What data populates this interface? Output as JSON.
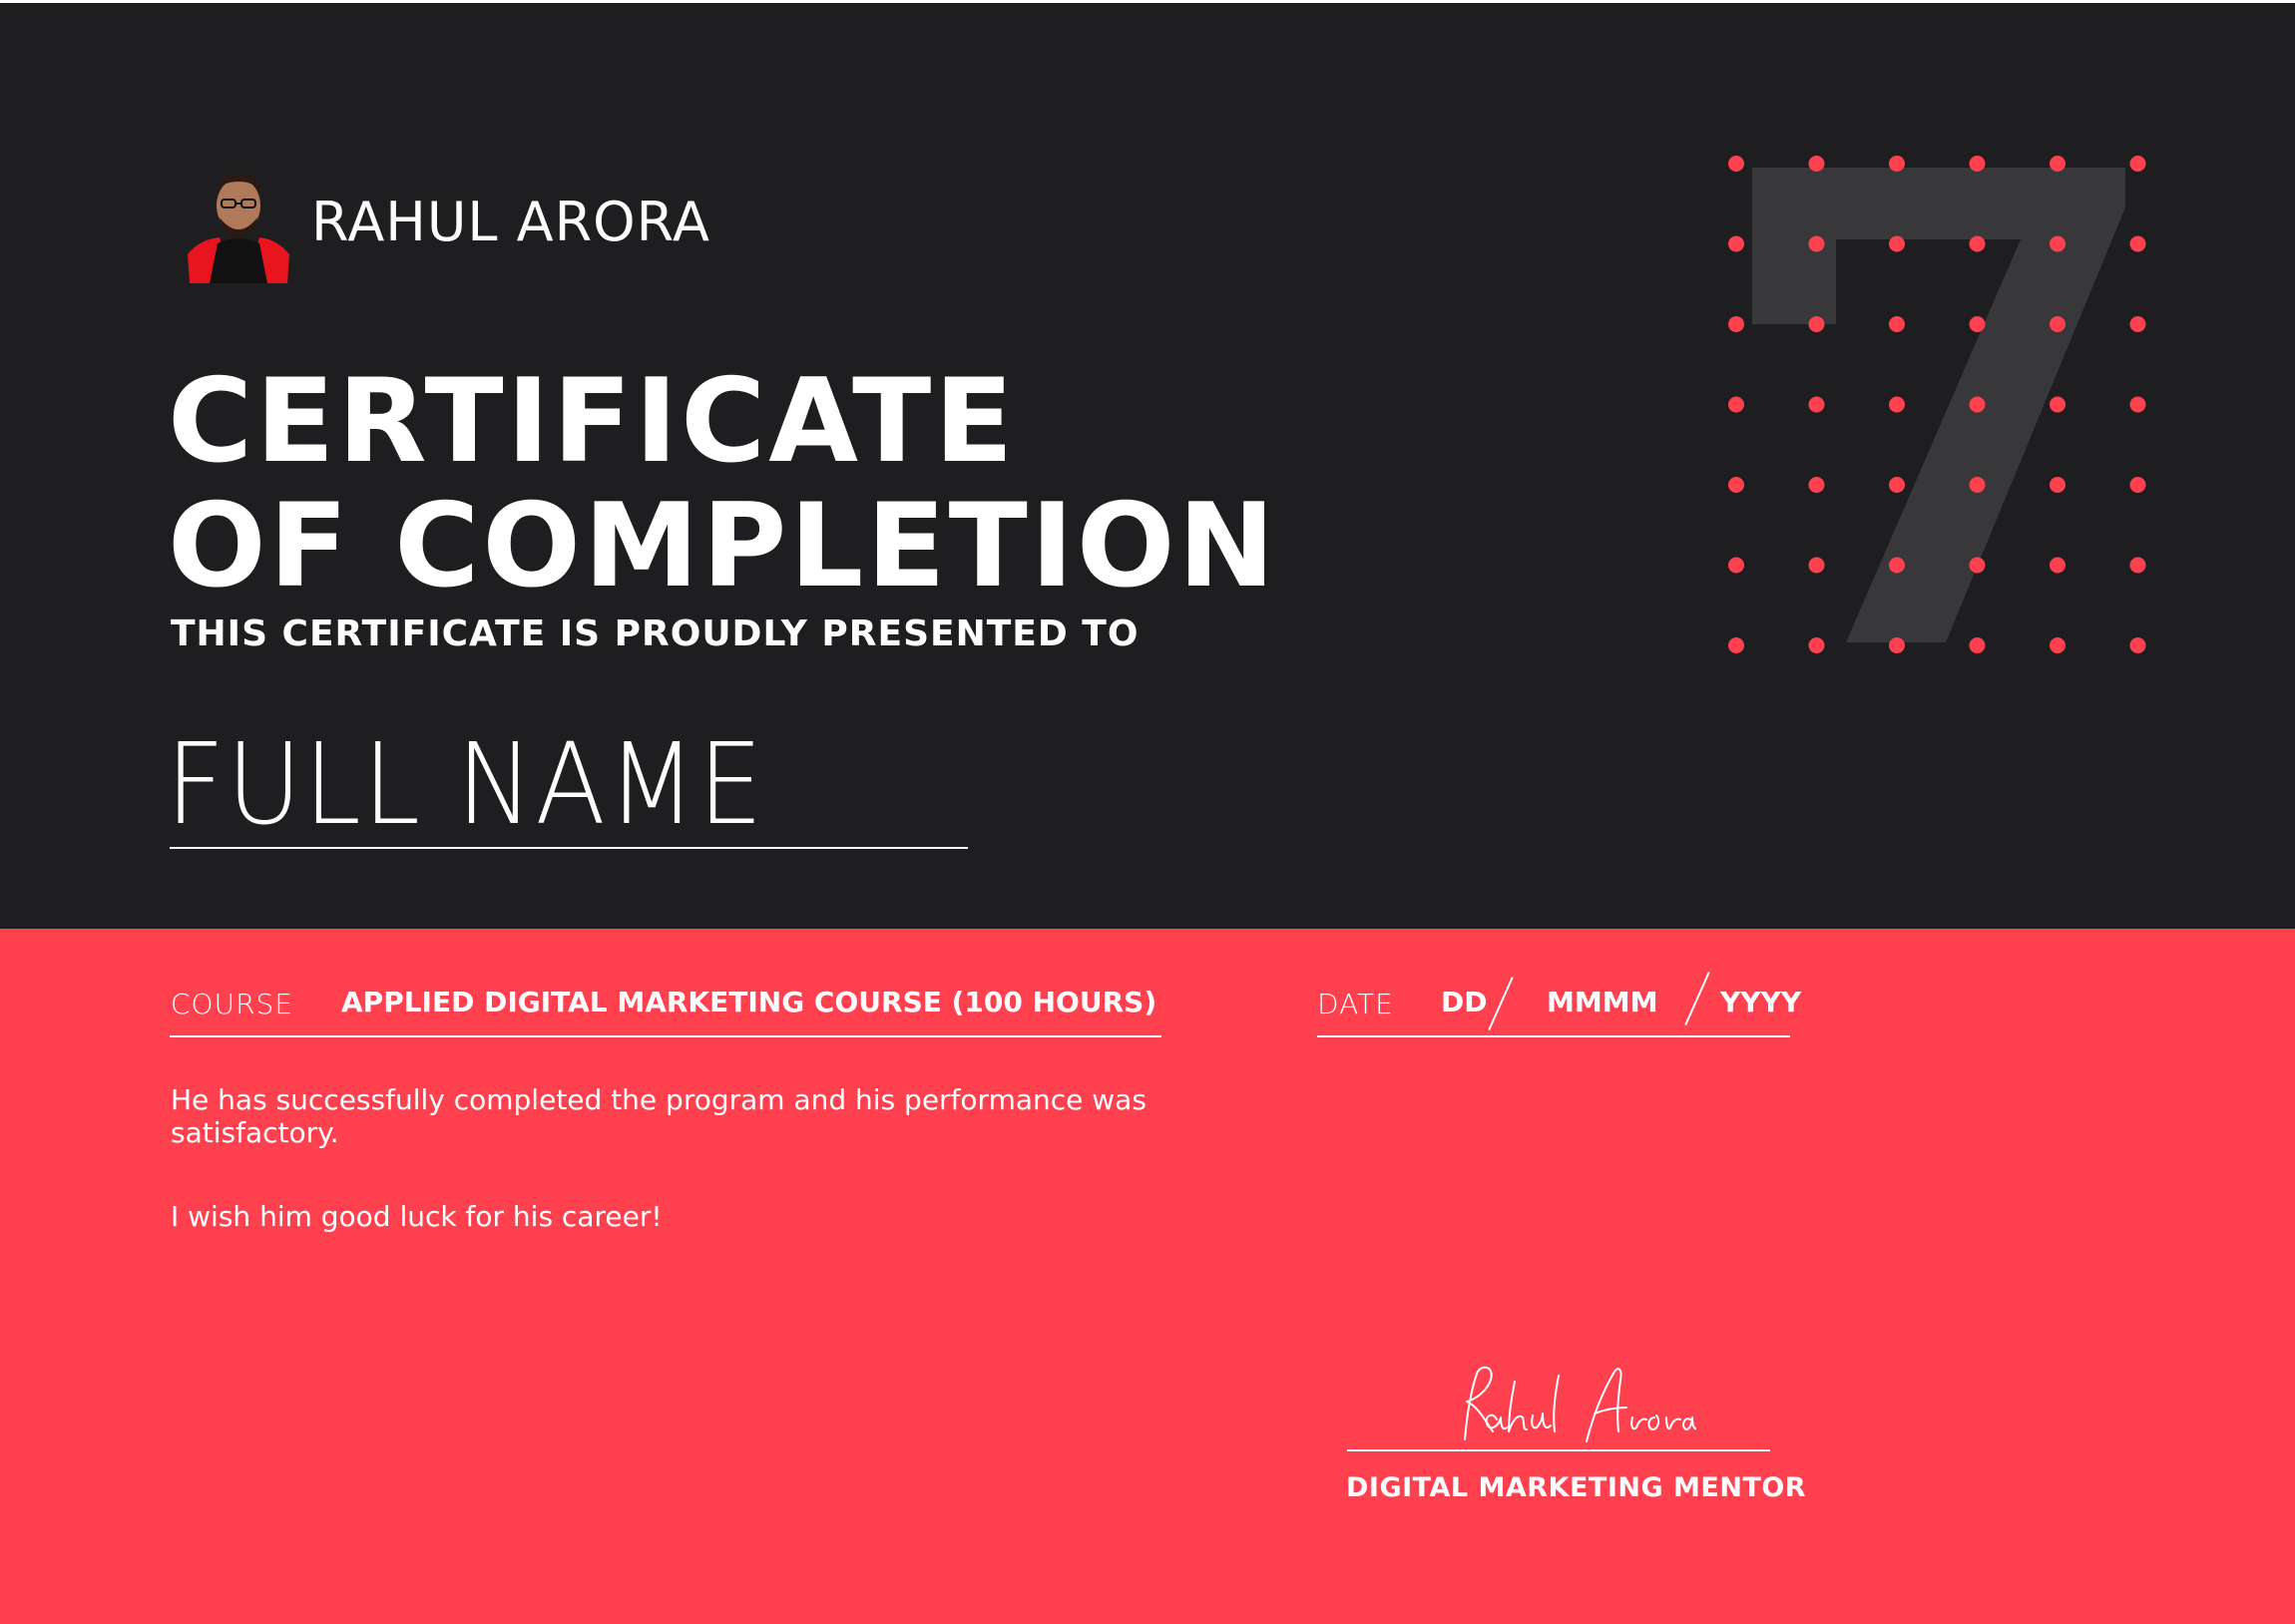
{
  "brand": {
    "name": "RAHUL ARORA",
    "avatar_icon": "profile-photo"
  },
  "certificate": {
    "title_line1": "CERTIFICATE",
    "title_line2": "OF COMPLETION",
    "presented_text": "THIS CERTIFICATE IS PROUDLY PRESENTED TO",
    "recipient_name": "FULL NAME"
  },
  "course": {
    "label": "COURSE",
    "value": "APPLIED DIGITAL MARKETING COURSE (100 HOURS)"
  },
  "date": {
    "label": "DATE",
    "day": "DD",
    "month": "MMMM",
    "year": "YYYY"
  },
  "message": {
    "paragraph1": "He has successfully completed the program and his performance was satisfactory.",
    "paragraph2": "I wish him good luck for his career!"
  },
  "signature": {
    "signer": "Rahul Arora",
    "role": "DIGITAL MARKETING MENTOR"
  },
  "colors": {
    "dark_background": "#1e1e20",
    "accent_red": "#ff404e",
    "seven_gray": "#38383a",
    "text_white": "#ffffff"
  },
  "decoration": {
    "numeral": "7",
    "dot_icon": "dot-grid"
  }
}
